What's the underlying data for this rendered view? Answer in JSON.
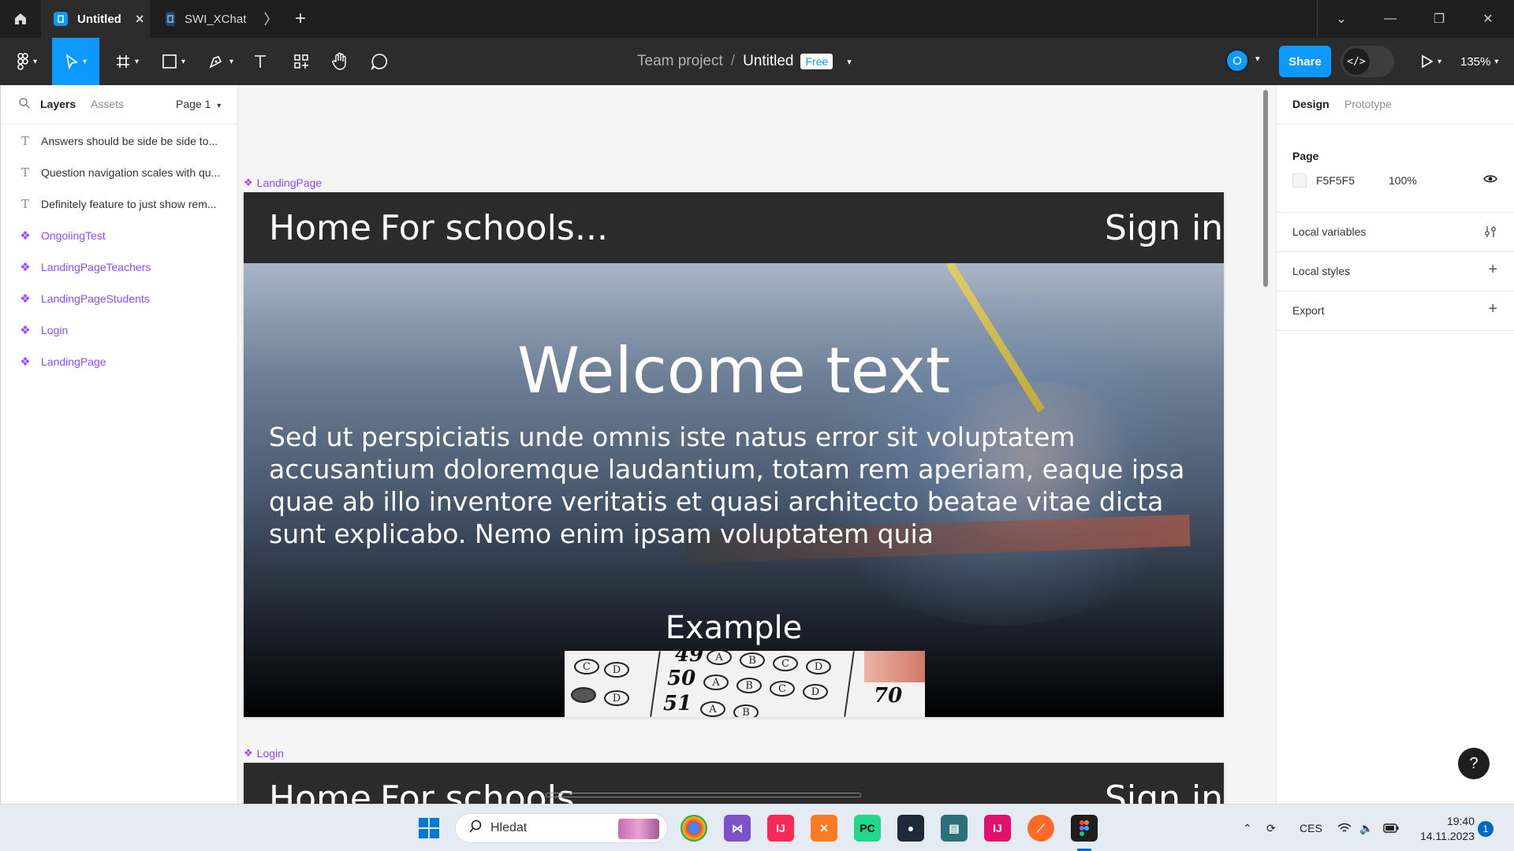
{
  "titlebar": {
    "tabs": [
      {
        "label": "Untitled",
        "active": true
      },
      {
        "label": "SWI_XChat",
        "active": false
      }
    ],
    "close_glyph": "×",
    "new_tab_glyph": "+",
    "window_controls": [
      "⌄",
      "—",
      "❐",
      "✕"
    ]
  },
  "toolbar": {
    "project": "Team project",
    "separator": "/",
    "file_name": "Untitled",
    "plan_badge": "Free",
    "avatar_initial": "O",
    "share_label": "Share",
    "devmode_glyph": "</>",
    "zoom": "135%",
    "tools": [
      "main-menu-icon",
      "move-icon",
      "frame-icon",
      "rectangle-icon",
      "pen-icon",
      "text-icon",
      "resources-icon",
      "hand-icon",
      "comment-icon"
    ]
  },
  "left_panel": {
    "tabs": [
      "Layers",
      "Assets"
    ],
    "page_selector": "Page 1",
    "layers": [
      {
        "type": "text",
        "label": "Answers should be side be side to..."
      },
      {
        "type": "text",
        "label": "Question navigation scales with qu..."
      },
      {
        "type": "text",
        "label": "Definitely feature to just show rem..."
      },
      {
        "type": "component",
        "label": "OngoiingTest"
      },
      {
        "type": "component",
        "label": "LandingPageTeachers"
      },
      {
        "type": "component",
        "label": "LandingPageStudents"
      },
      {
        "type": "component",
        "label": "Login"
      },
      {
        "type": "component",
        "label": "LandingPage"
      }
    ]
  },
  "canvas": {
    "frames": [
      {
        "label": "LandingPage",
        "nav": {
          "home": "Home",
          "schools": "For schools",
          "more": "...",
          "signin": "Sign in"
        },
        "hero_title": "Welcome text",
        "hero_text": "Sed ut perspiciatis unde omnis iste natus error sit voluptatem accusantium doloremque laudantium, totam rem aperiam, eaque ipsa quae ab illo inventore veritatis et quasi architecto beatae vitae dicta sunt explicabo. Nemo enim ipsam voluptatem quia",
        "example_title": "Example",
        "example_numbers": [
          "49",
          "50",
          "51",
          "70"
        ],
        "example_options": [
          "A",
          "B",
          "C",
          "D"
        ]
      },
      {
        "label": "Login",
        "nav": {
          "home": "Home",
          "schools": "For schools",
          "signin": "Sign in"
        }
      }
    ]
  },
  "right_panel": {
    "tabs": [
      "Design",
      "Prototype"
    ],
    "page_section_title": "Page",
    "page_color": "F5F5F5",
    "page_opacity": "100%",
    "local_variables": "Local variables",
    "local_styles": "Local styles",
    "export": "Export",
    "help": "?"
  },
  "taskbar": {
    "search_placeholder": "Hledat",
    "language": "CES",
    "time": "19:40",
    "date": "14.11.2023",
    "notifications": "1"
  },
  "colors": {
    "accent": "#0d99ff",
    "component": "#9747ff",
    "canvas_bg": "#F5F5F5",
    "nav_bg": "#2b2b2b"
  }
}
